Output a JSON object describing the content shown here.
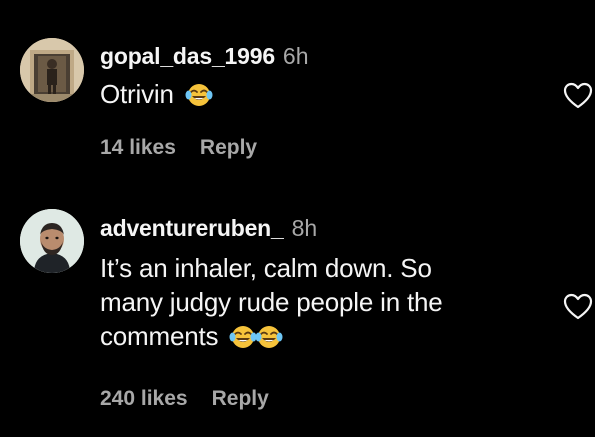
{
  "comments": [
    {
      "username": "gopal_das_1996",
      "time": "6h",
      "text": "Otrivin",
      "emoji_count": 1,
      "likes": "14 likes",
      "reply_label": "Reply",
      "avatar_icon": "person-photo-icon"
    },
    {
      "username": "adventureruben_",
      "time": "8h",
      "text_line1": "It’s an inhaler, calm down. So",
      "text_line2": "many judgy rude people in the",
      "text_line3": "comments",
      "emoji_count": 2,
      "likes": "240 likes",
      "reply_label": "Reply",
      "avatar_icon": "person-photo-icon"
    }
  ],
  "colors": {
    "background": "#000000",
    "text": "#f5f5f5",
    "secondary": "#a8a8a8"
  },
  "icons": {
    "like": "heart-outline-icon",
    "emoji": "face-with-tears-of-joy-icon"
  }
}
